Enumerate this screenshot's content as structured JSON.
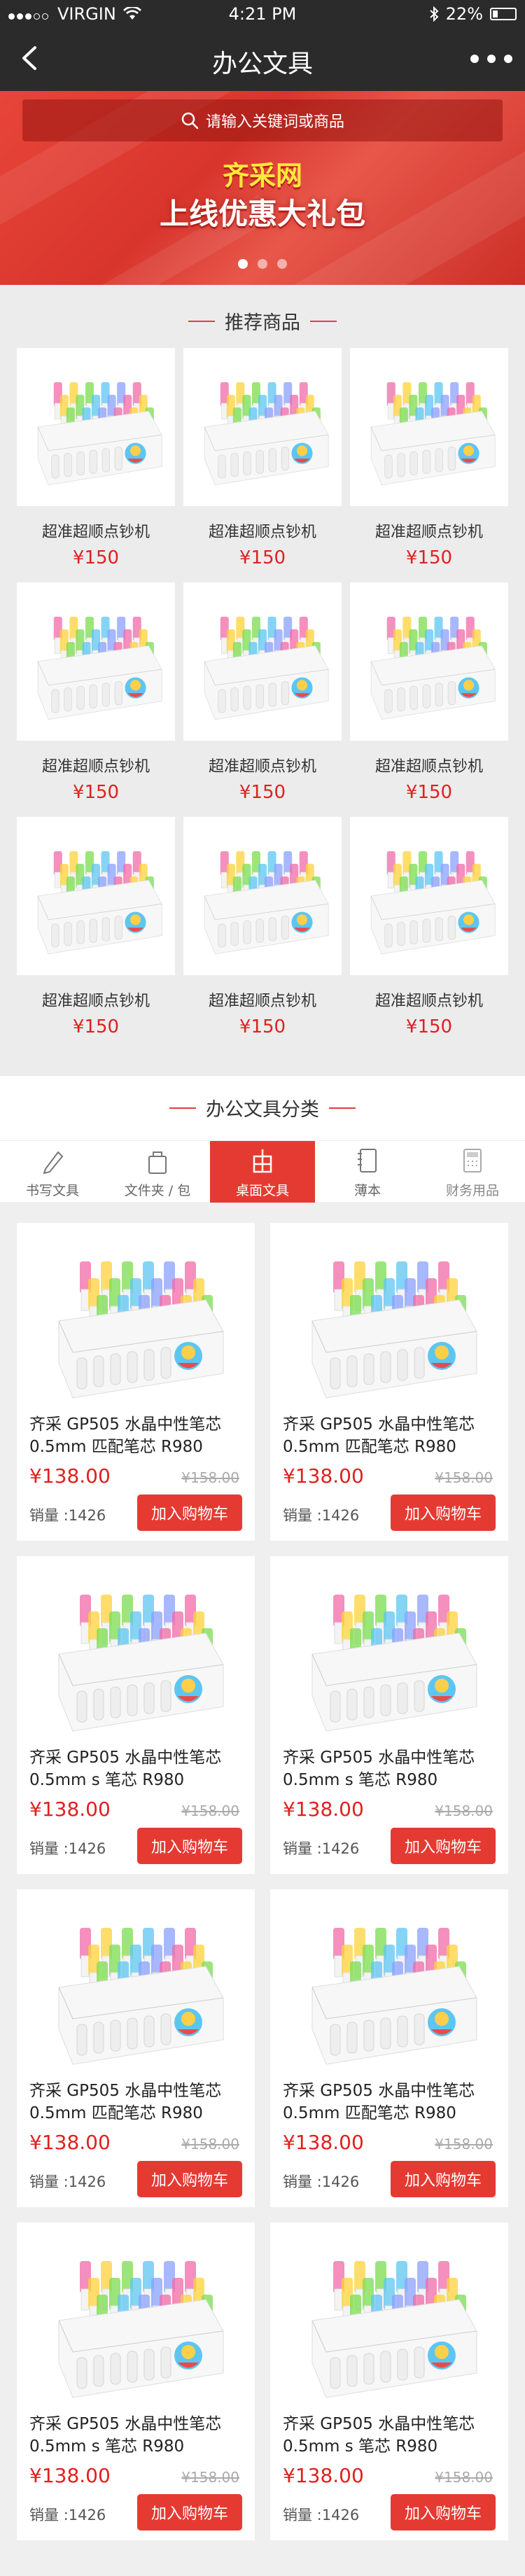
{
  "status_bar": {
    "carrier": "VIRGIN",
    "time": "4:21 PM",
    "battery": "22%",
    "battery_level": 0.22
  },
  "nav": {
    "title": "办公文具",
    "back_icon": "chevron-left-icon",
    "more_icon": "more-dots-icon"
  },
  "banner": {
    "search_placeholder": "请输入关键词或商品",
    "headline_brand": "齐采网",
    "headline_promo": "上线优惠大礼包",
    "page_indicator": {
      "count": 3,
      "active": 0
    }
  },
  "recommend": {
    "title": "推荐商品",
    "items": [
      {
        "name": "超准超顺点钞机",
        "price": "¥150"
      },
      {
        "name": "超准超顺点钞机",
        "price": "¥150"
      },
      {
        "name": "超准超顺点钞机",
        "price": "¥150"
      },
      {
        "name": "超准超顺点钞机",
        "price": "¥150"
      },
      {
        "name": "超准超顺点钞机",
        "price": "¥150"
      },
      {
        "name": "超准超顺点钞机",
        "price": "¥150"
      },
      {
        "name": "超准超顺点钞机",
        "price": "¥150"
      },
      {
        "name": "超准超顺点钞机",
        "price": "¥150"
      },
      {
        "name": "超准超顺点钞机",
        "price": "¥150"
      }
    ]
  },
  "category": {
    "title": "办公文具分类",
    "tabs": [
      {
        "label": "书写文具",
        "icon": "pen-icon"
      },
      {
        "label": "文件夹 / 包",
        "icon": "bag-icon"
      },
      {
        "label": "桌面文具",
        "icon": "desk-organizer-icon",
        "active": true
      },
      {
        "label": "薄本",
        "icon": "notebook-icon"
      },
      {
        "label": "财务用品",
        "icon": "calculator-icon"
      }
    ],
    "products": [
      {
        "name": "齐采 GP505 水晶中性笔芯 0.5mm 匹配笔芯 R980",
        "price": "¥138.00",
        "old_price": "¥158.00",
        "sold": "销量 :1426",
        "button": "加入购物车"
      },
      {
        "name": "齐采 GP505 水晶中性笔芯 0.5mm 匹配笔芯 R980",
        "price": "¥138.00",
        "old_price": "¥158.00",
        "sold": "销量 :1426",
        "button": "加入购物车"
      },
      {
        "name": "齐采 GP505 水晶中性笔芯 0.5mm s 笔芯 R980",
        "price": "¥138.00",
        "old_price": "¥158.00",
        "sold": "销量 :1426",
        "button": "加入购物车"
      },
      {
        "name": "齐采 GP505 水晶中性笔芯 0.5mm s 笔芯 R980",
        "price": "¥138.00",
        "old_price": "¥158.00",
        "sold": "销量 :1426",
        "button": "加入购物车"
      },
      {
        "name": "齐采 GP505 水晶中性笔芯 0.5mm 匹配笔芯 R980",
        "price": "¥138.00",
        "old_price": "¥158.00",
        "sold": "销量 :1426",
        "button": "加入购物车"
      },
      {
        "name": "齐采 GP505 水晶中性笔芯 0.5mm 匹配笔芯 R980",
        "price": "¥138.00",
        "old_price": "¥158.00",
        "sold": "销量 :1426",
        "button": "加入购物车"
      },
      {
        "name": "齐采 GP505 水晶中性笔芯 0.5mm s 笔芯 R980",
        "price": "¥138.00",
        "old_price": "¥158.00",
        "sold": "销量 :1426",
        "button": "加入购物车"
      },
      {
        "name": "齐采 GP505 水晶中性笔芯 0.5mm s 笔芯 R980",
        "price": "¥138.00",
        "old_price": "¥158.00",
        "sold": "销量 :1426",
        "button": "加入购物车"
      }
    ]
  },
  "colors": {
    "accent": "#e53a32",
    "price": "#e02020",
    "nav_bg": "#2b2b2b"
  }
}
